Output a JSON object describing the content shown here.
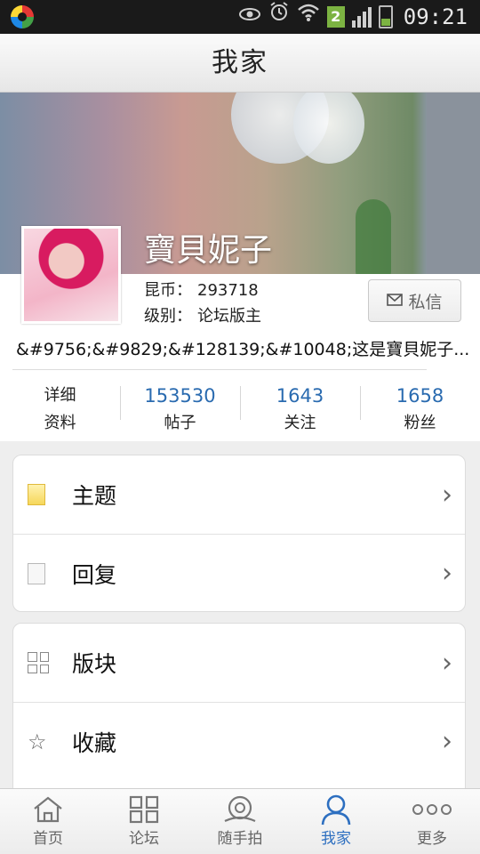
{
  "status_bar": {
    "time": "09:21",
    "sim_number": "2",
    "icons": [
      "app-launcher-icon",
      "eye-icon",
      "alarm-icon",
      "wifi-icon",
      "sim-icon",
      "signal-icon",
      "battery-icon"
    ],
    "battery_level": 0.35
  },
  "header": {
    "title": "我家"
  },
  "profile": {
    "username": "寶貝妮子",
    "coins_label": "昆币：",
    "coins_value": "293718",
    "level_label": "级别：",
    "level_value": "论坛版主",
    "message_button": "私信",
    "signature": "&#9756;&#9829;&#128139;&#10048;这是寶貝妮子..."
  },
  "stats": [
    {
      "value": "详细",
      "label": "资料"
    },
    {
      "value": "153530",
      "label": "帖子"
    },
    {
      "value": "1643",
      "label": "关注"
    },
    {
      "value": "1658",
      "label": "粉丝"
    }
  ],
  "menu_group1": [
    {
      "label": "主题",
      "icon": "document-yellow-icon"
    },
    {
      "label": "回复",
      "icon": "document-gray-icon"
    }
  ],
  "menu_group2": [
    {
      "label": "版块",
      "icon": "grid-icon"
    },
    {
      "label": "收藏",
      "icon": "star-icon"
    }
  ],
  "bottom_nav": [
    {
      "label": "首页",
      "icon": "home-icon"
    },
    {
      "label": "论坛",
      "icon": "grid-icon"
    },
    {
      "label": "随手拍",
      "icon": "camera-lens-icon"
    },
    {
      "label": "我家",
      "icon": "person-icon",
      "active": true
    },
    {
      "label": "更多",
      "icon": "more-dots-icon"
    }
  ],
  "colors": {
    "accent": "#2d6fc0",
    "stat_number": "#2a6bb0"
  }
}
